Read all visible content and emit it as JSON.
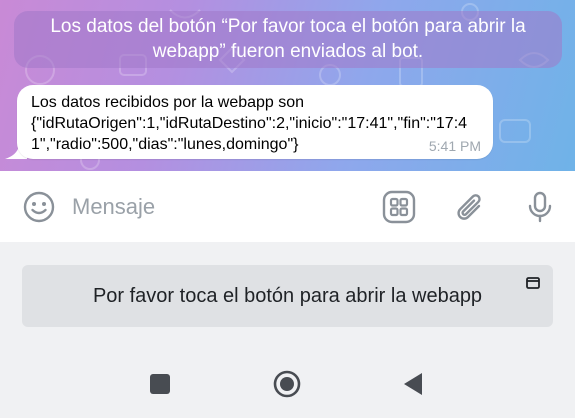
{
  "chat": {
    "service_message": "Los datos del botón “Por favor toca el botón para abrir la webapp” fueron enviados al bot.",
    "incoming_message": {
      "text": "Los datos recibidos por la webapp son\n{\"idRutaOrigen\":1,\"idRutaDestino\":2,\"inicio\":\"17:41\",\"fin\":\"17:41\",\"radio\":500,\"dias\":\"lunes,domingo\"}",
      "time": "5:41 PM"
    }
  },
  "input_bar": {
    "placeholder": "Mensaje",
    "icons": [
      "emoji-icon",
      "bot-keyboard-icon",
      "attach-icon",
      "microphone-icon"
    ]
  },
  "bot_keyboard": {
    "button_label": "Por favor toca el botón para abrir la webapp",
    "button_icon": "webapp-icon"
  },
  "nav_bar": {
    "icons": [
      "recents-icon",
      "home-icon",
      "back-icon"
    ]
  },
  "colors": {
    "accent": "#4f9bd9",
    "icon_gray": "#8a9199"
  }
}
